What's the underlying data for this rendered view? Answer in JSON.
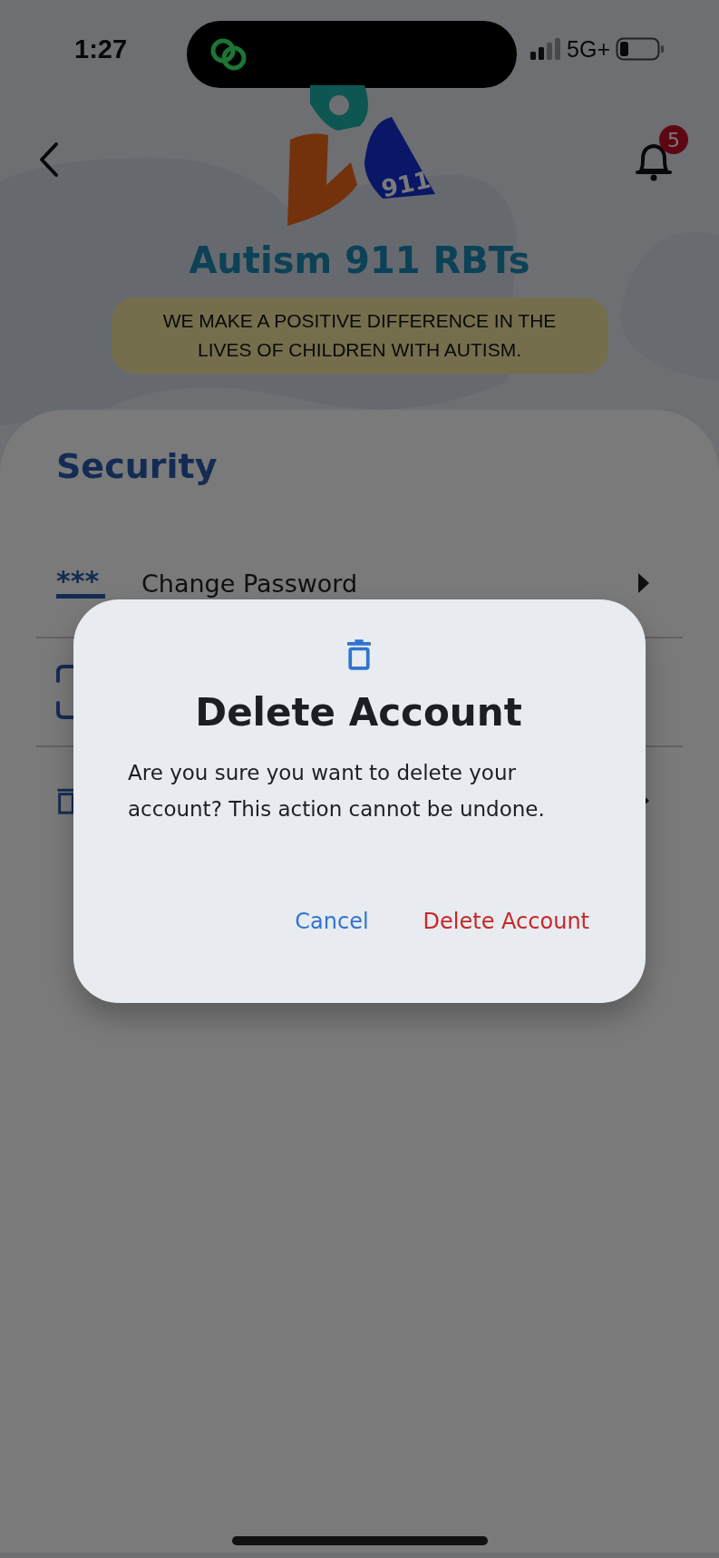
{
  "status_bar": {
    "time": "1:27",
    "network": "5G+"
  },
  "header": {
    "notification_count": "5"
  },
  "brand": {
    "logo_text": "911",
    "name": "Autism 911 RBTs",
    "tagline": "WE MAKE A POSITIVE DIFFERENCE IN THE LIVES OF CHILDREN WITH AUTISM."
  },
  "security": {
    "title": "Security",
    "items": [
      {
        "kind": "password",
        "icon_text": "***",
        "label": "Change Password"
      },
      {
        "kind": "face"
      },
      {
        "kind": "delete"
      }
    ]
  },
  "dialog": {
    "title": "Delete Account",
    "message": "Are you sure you want to delete your account? This action cannot be undone.",
    "buttons": [
      {
        "kind": "cancel",
        "label": "Cancel"
      },
      {
        "kind": "destructive",
        "label": "Delete Account"
      }
    ]
  }
}
